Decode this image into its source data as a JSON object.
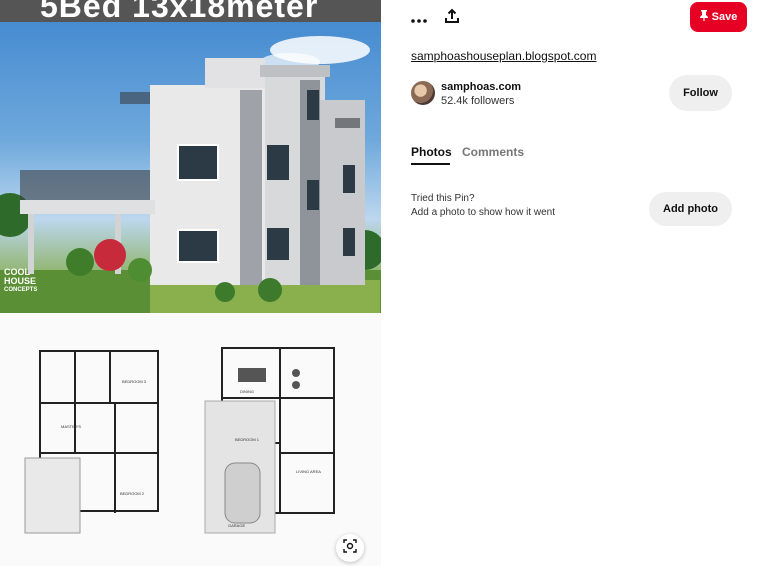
{
  "image": {
    "title_text": "5Bed 13x18meter",
    "brand_lines": [
      "COOL",
      "HOUSE",
      "CONCEPTS"
    ],
    "alt": "floor plan and 3D render"
  },
  "toolbar": {
    "more_icon": "more-horizontal-icon",
    "share_icon": "share-upload-icon",
    "save_label": "Save",
    "save_color": "#e60023"
  },
  "source": {
    "link_text": "samphoashouseplan.blogspot.com"
  },
  "creator": {
    "name": "samphoas.com",
    "followers": "52.4k followers",
    "follow_label": "Follow"
  },
  "tabs": [
    {
      "label": "Photos",
      "active": true
    },
    {
      "label": "Comments",
      "active": false
    }
  ],
  "tried": {
    "question": "Tried this Pin?",
    "hint": "Add a photo to show how it went",
    "button_label": "Add photo"
  },
  "lens_icon": "visual-search-icon"
}
